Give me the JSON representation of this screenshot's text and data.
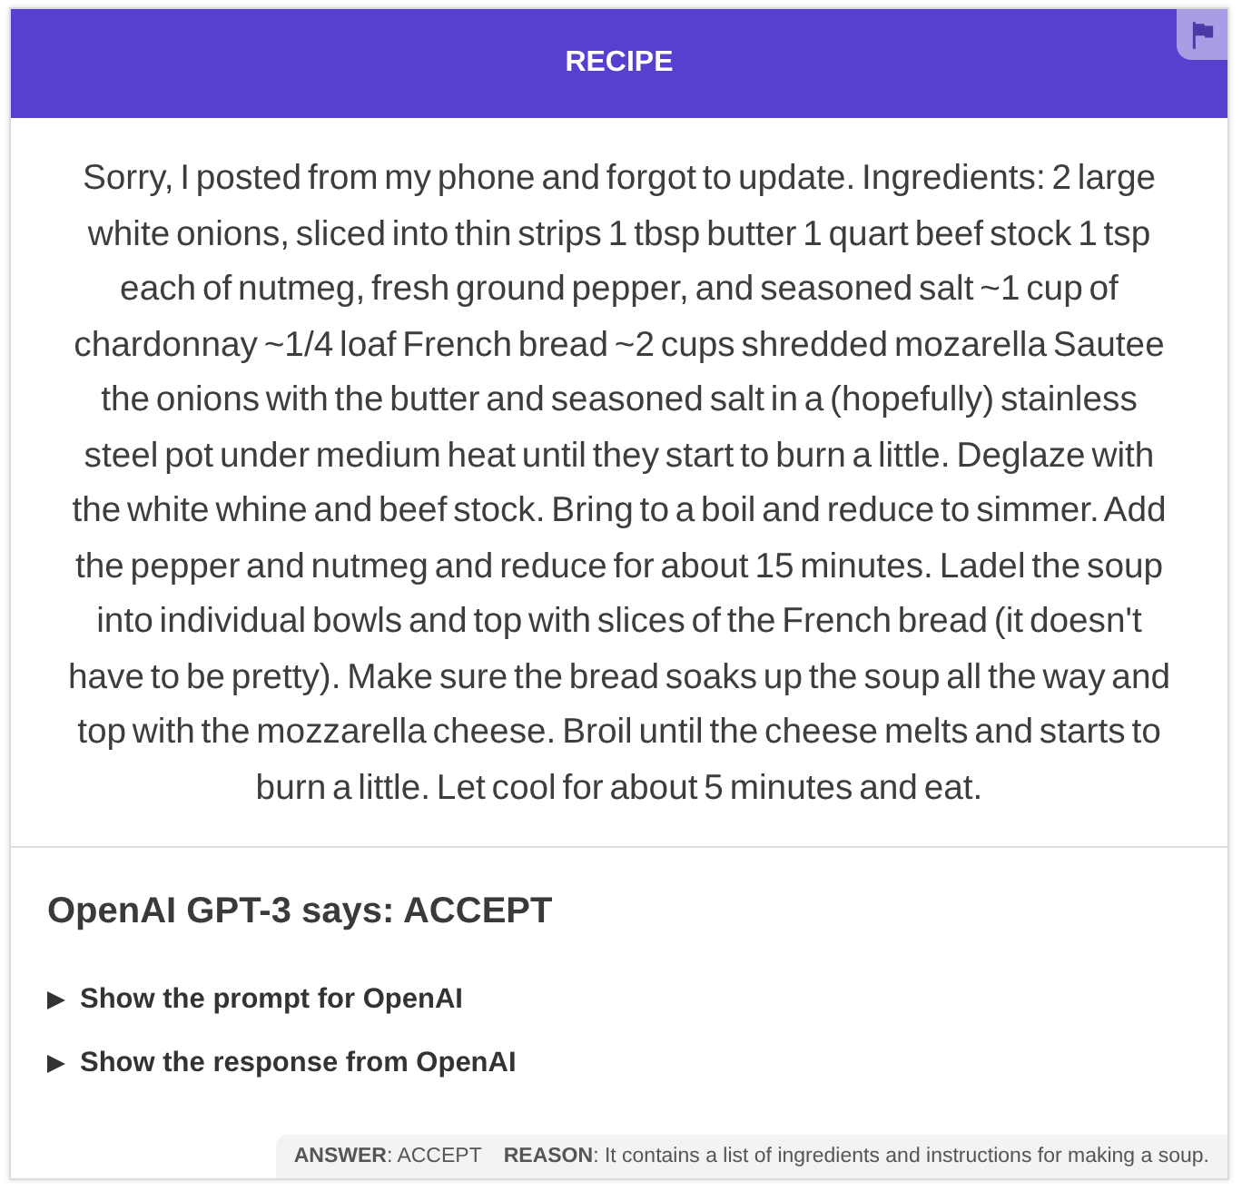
{
  "header": {
    "title": "RECIPE"
  },
  "body": {
    "text": "Sorry, I posted from my phone and forgot to update. Ingredients: 2 large white onions, sliced into thin strips 1 tbsp butter 1 quart beef stock 1 tsp each of nutmeg, fresh ground pepper, and seasoned salt ~1 cup of chardonnay ~1/4 loaf French bread ~2 cups shredded mozarella Sautee the onions with the butter and seasoned salt in a (hopefully) stainless steel pot under medium heat until they start to burn a little. Deglaze with the white whine and beef stock. Bring to a boil and reduce to simmer. Add the pepper and nutmeg and reduce for about 15 minutes. Ladel the soup into individual bowls and top with slices of the French bread (it doesn't have to be pretty). Make sure the bread soaks up the soup all the way and top with the mozzarella cheese. Broil until the cheese melts and starts to burn a little. Let cool for about 5 minutes and eat."
  },
  "verdict": {
    "heading": "OpenAI GPT-3 says: ACCEPT",
    "disclosures": [
      {
        "label": "Show the prompt for OpenAI",
        "expanded": false
      },
      {
        "label": "Show the response from OpenAI",
        "expanded": false
      }
    ]
  },
  "footer": {
    "answer": "**ANSWER**: ACCEPT",
    "reason": "**REASON**: It contains a list of ingredients and instructions for making a soup."
  }
}
